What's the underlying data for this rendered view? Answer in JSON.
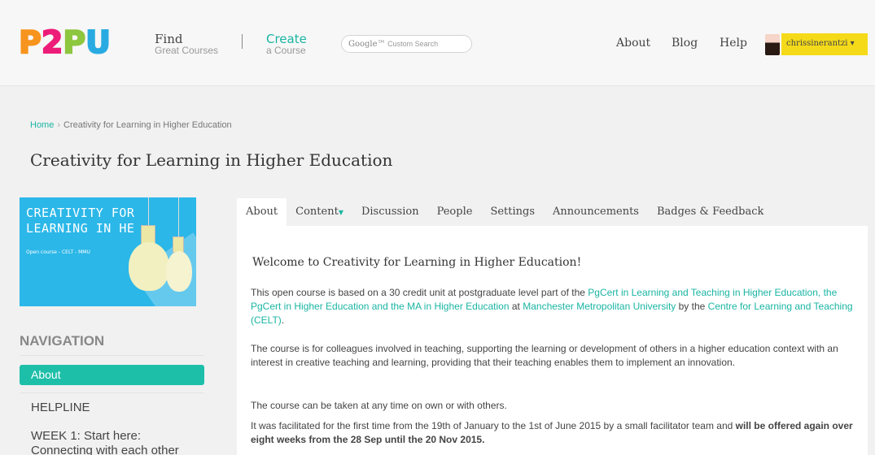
{
  "header": {
    "logo_letters": [
      "P",
      "2",
      "P",
      "U"
    ],
    "find_title": "Find",
    "find_subtitle": "Great Courses",
    "create_title": "Create",
    "create_subtitle": "a Course",
    "search_brand": "Google™",
    "search_placeholder": "Custom Search",
    "nav": [
      "About",
      "Blog",
      "Help"
    ],
    "username": "chrissinerantzi ▾"
  },
  "breadcrumb": {
    "home": "Home",
    "separator": "›",
    "current": "Creativity for Learning in Higher Education"
  },
  "page_title": "Creativity for Learning in Higher Education",
  "banner": {
    "line1": "CREATIVITY FOR",
    "line2": "LEARNING IN HE",
    "subtitle": "Open course - CELT - MMU"
  },
  "sidebar": {
    "heading": "NAVIGATION",
    "active_item": "About",
    "items": [
      "HELPLINE",
      "WEEK 1: Start here:",
      "Connecting with each other"
    ]
  },
  "tabs": [
    "About",
    "Content",
    "Discussion",
    "People",
    "Settings",
    "Announcements",
    "Badges & Feedback"
  ],
  "content": {
    "welcome": "Welcome to Creativity for Learning in Higher Education!",
    "p1": {
      "a": "This open course is based on a 30 credit unit at postgraduate level part of the ",
      "link1": "PgCert in Learning and Teaching in Higher Education, the PgCert in Higher Education and the MA in Higher Education",
      "b": " at ",
      "link2": "Manchester Metropolitan University",
      "c": " by the ",
      "link3": "Centre for Learning and Teaching (CELT)",
      "d": "."
    },
    "p2": "The course is for colleagues involved in teaching, supporting the learning or development of others in a higher education context with an interest in creative teaching and learning, providing that their teaching enables them to implement an innovation.",
    "p3": "The course can be taken at any time on own or with others.",
    "p4": {
      "a": "It was facilitated for the first time from the 19th of January to the 1st of June 2015 by a small facilitator team and ",
      "bold": "will be offered again over eight weeks from the 28 Sep until the 20 Nov 2015."
    }
  },
  "colors": {
    "accent": "#1ab5a3",
    "user_button": "#f5da1a",
    "banner": "#2bb7e8"
  }
}
